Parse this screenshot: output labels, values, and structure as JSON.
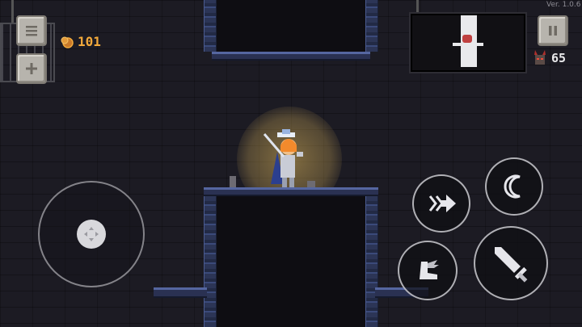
{
  "hud": {
    "version": "Ver. 1.0.6",
    "coins": "101",
    "kills": "65"
  },
  "icons": {
    "menu": "menu-icon",
    "add": "plus-icon",
    "pause": "pause-icon",
    "coin": "coin-icon",
    "kills": "demon-head-icon",
    "joystick": "joystick-icon",
    "dash": "dash-arrow-icon",
    "skill": "crescent-icon",
    "jump": "winged-boot-icon",
    "attack": "sword-icon"
  },
  "colors": {
    "coin_text": "#f2a93b",
    "button_border": "#e6e6eb",
    "wall": "#3b4a7a",
    "glow": "#d8b25a"
  }
}
